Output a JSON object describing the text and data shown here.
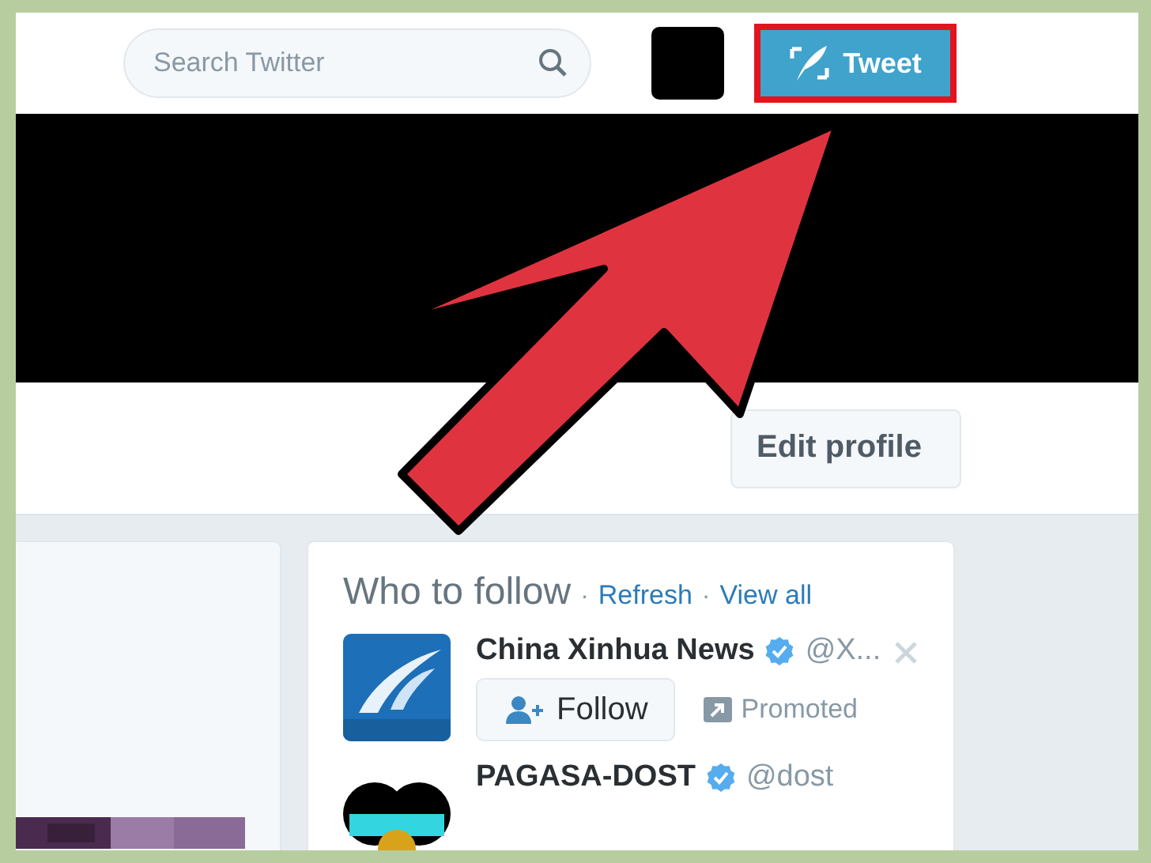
{
  "search": {
    "placeholder": "Search Twitter"
  },
  "tweet_button": {
    "label": "Tweet",
    "highlighted": true
  },
  "edit_profile": {
    "label": "Edit profile"
  },
  "who_to_follow": {
    "title": "Who to follow",
    "links": [
      {
        "separator": "·",
        "label": "Refresh"
      },
      {
        "separator": "·",
        "label": "View all"
      }
    ],
    "accounts": [
      {
        "name": "China Xinhua News",
        "verified": true,
        "handle": "@X...",
        "follow_label": "Follow",
        "promoted": "Promoted",
        "dismissible": true
      },
      {
        "name": "PAGASA-DOST",
        "verified": true,
        "handle": "@dost"
      }
    ]
  }
}
